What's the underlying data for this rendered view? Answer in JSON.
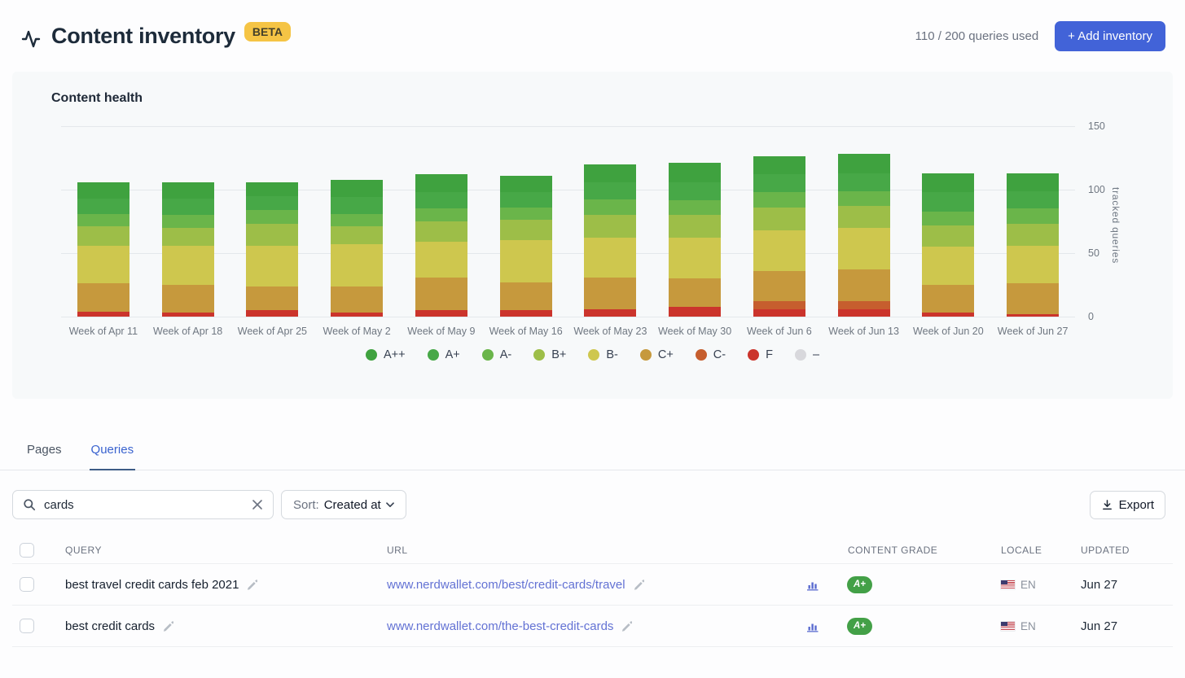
{
  "header": {
    "title": "Content inventory",
    "beta_badge": "BETA",
    "queries_used": "110 / 200 queries used",
    "add_inventory_label": "+ Add inventory",
    "accent_color": "#4263D8"
  },
  "chart_card": {
    "title": "Content health"
  },
  "chart_data": {
    "type": "bar",
    "stacked": true,
    "title": "Content health",
    "xlabel": "",
    "ylabel": "tracked queries",
    "ylim": [
      0,
      150
    ],
    "yticks": [
      0,
      50,
      100,
      150
    ],
    "grid": true,
    "legend_position": "bottom",
    "categories": [
      "Week of Apr 11",
      "Week of Apr 18",
      "Week of Apr 25",
      "Week of May 2",
      "Week of May 9",
      "Week of May 16",
      "Week of May 23",
      "Week of May 30",
      "Week of Jun 6",
      "Week of Jun 13",
      "Week of Jun 20",
      "Week of Jun 27"
    ],
    "series": [
      {
        "name": "A++",
        "color": "#3FA23F",
        "values": [
          13,
          13,
          11,
          14,
          14,
          13,
          14,
          15,
          14,
          15,
          15,
          14
        ]
      },
      {
        "name": "A+",
        "color": "#47A847",
        "values": [
          12,
          13,
          11,
          13,
          13,
          12,
          14,
          14,
          14,
          14,
          15,
          14
        ]
      },
      {
        "name": "A-",
        "color": "#6AB54A",
        "values": [
          10,
          10,
          11,
          10,
          10,
          10,
          12,
          12,
          12,
          12,
          11,
          12
        ]
      },
      {
        "name": "B+",
        "color": "#9DBE48",
        "values": [
          15,
          14,
          17,
          14,
          16,
          16,
          18,
          18,
          18,
          17,
          17,
          17
        ]
      },
      {
        "name": "B-",
        "color": "#CEC74E",
        "values": [
          30,
          31,
          32,
          33,
          28,
          33,
          31,
          32,
          32,
          33,
          30,
          30
        ]
      },
      {
        "name": "C+",
        "color": "#C6993D",
        "values": [
          22,
          22,
          19,
          21,
          26,
          22,
          25,
          22,
          24,
          25,
          22,
          24
        ]
      },
      {
        "name": "C-",
        "color": "#C65E2E",
        "values": [
          0,
          0,
          0,
          0,
          0,
          0,
          0,
          0,
          6,
          6,
          0,
          0
        ]
      },
      {
        "name": "F",
        "color": "#CB342C",
        "values": [
          4,
          3,
          5,
          3,
          5,
          5,
          6,
          8,
          6,
          6,
          3,
          2
        ]
      },
      {
        "name": "–",
        "color": "#D8D8DC",
        "values": [
          0,
          0,
          0,
          0,
          0,
          0,
          0,
          0,
          0,
          0,
          0,
          0
        ]
      }
    ],
    "totals": [
      106,
      106,
      106,
      108,
      112,
      111,
      120,
      121,
      126,
      128,
      113,
      113
    ]
  },
  "tabs": [
    {
      "label": "Pages",
      "active": false
    },
    {
      "label": "Queries",
      "active": true
    }
  ],
  "toolbar": {
    "search_value": "cards",
    "sort_prefix": "Sort:",
    "sort_value": "Created at",
    "export_label": "Export"
  },
  "table": {
    "headers": [
      "QUERY",
      "URL",
      "CONTENT GRADE",
      "LOCALE",
      "UPDATED"
    ],
    "rows": [
      {
        "query": "best travel credit cards feb 2021",
        "url": "www.nerdwallet.com/best/credit-cards/travel",
        "grade": "A+",
        "grade_color": "#43A047",
        "locale": "EN",
        "updated": "Jun 27"
      },
      {
        "query": "best credit cards",
        "url": "www.nerdwallet.com/the-best-credit-cards",
        "grade": "A+",
        "grade_color": "#43A047",
        "locale": "EN",
        "updated": "Jun 27"
      }
    ]
  }
}
